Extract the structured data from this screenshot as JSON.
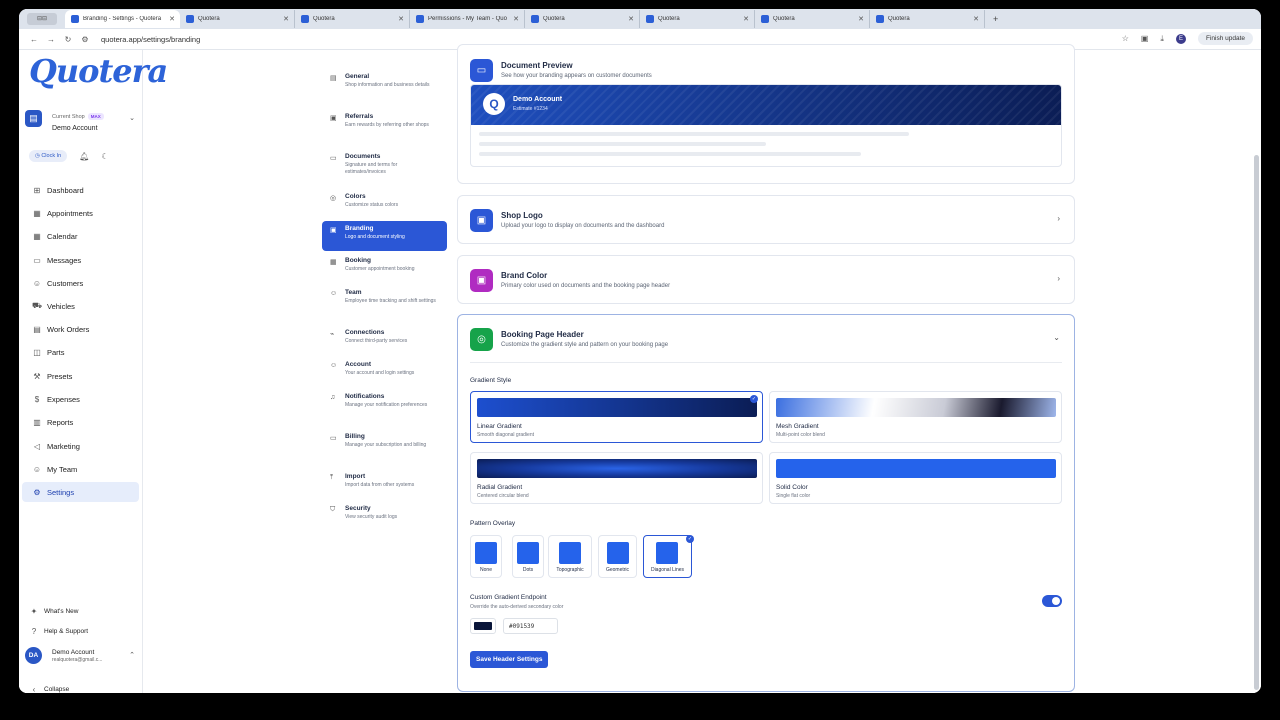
{
  "browser": {
    "home_tab": "⊟⊟",
    "tabs": [
      {
        "title": "Branding - Settings - Quotera",
        "active": true
      },
      {
        "title": "Quotera"
      },
      {
        "title": "Quotera"
      },
      {
        "title": "Permissions - My Team - Quo"
      },
      {
        "title": "Quotera"
      },
      {
        "title": "Quotera"
      },
      {
        "title": "Quotera"
      },
      {
        "title": "Quotera"
      }
    ],
    "new_tab": "+",
    "url": "quotera.app/settings/branding",
    "profile_initial": "E",
    "finish_update": "Finish update"
  },
  "sidebar": {
    "logo": "Quotera",
    "shop_label": "Current Shop",
    "shop_badge": "MAX",
    "shop_name": "Demo Account",
    "clock_in": "Clock In",
    "items": [
      {
        "label": "Dashboard",
        "icon": "grid-icon"
      },
      {
        "label": "Appointments",
        "icon": "calendar-check-icon"
      },
      {
        "label": "Calendar",
        "icon": "calendar-icon"
      },
      {
        "label": "Messages",
        "icon": "message-icon"
      },
      {
        "label": "Customers",
        "icon": "users-icon"
      },
      {
        "label": "Vehicles",
        "icon": "car-icon"
      },
      {
        "label": "Work Orders",
        "icon": "clipboard-icon"
      },
      {
        "label": "Parts",
        "icon": "box-icon"
      },
      {
        "label": "Presets",
        "icon": "wrench-icon"
      },
      {
        "label": "Expenses",
        "icon": "dollar-icon"
      },
      {
        "label": "Reports",
        "icon": "chart-icon"
      },
      {
        "label": "Marketing",
        "icon": "megaphone-icon"
      },
      {
        "label": "My Team",
        "icon": "team-icon"
      },
      {
        "label": "Settings",
        "icon": "gear-icon",
        "active": true
      }
    ],
    "whats_new": "What's New",
    "help": "Help & Support",
    "user_initials": "DA",
    "user_name": "Demo Account",
    "user_email": "realquotera@gmail.c...",
    "collapse": "Collapse"
  },
  "settings_nav": [
    {
      "title": "General",
      "desc": "Shop information and business details"
    },
    {
      "title": "Referrals",
      "desc": "Earn rewards by referring other shops"
    },
    {
      "title": "Documents",
      "desc": "Signature and terms for estimates/invoices"
    },
    {
      "title": "Colors",
      "desc": "Customize status colors"
    },
    {
      "title": "Branding",
      "desc": "Logo and document styling",
      "active": true
    },
    {
      "title": "Booking",
      "desc": "Customer appointment booking"
    },
    {
      "title": "Team",
      "desc": "Employee time tracking and shift settings"
    },
    {
      "title": "Connections",
      "desc": "Connect third-party services"
    },
    {
      "title": "Account",
      "desc": "Your account and login settings"
    },
    {
      "title": "Notifications",
      "desc": "Manage your notification preferences"
    },
    {
      "title": "Billing",
      "desc": "Manage your subscription and billing"
    },
    {
      "title": "Import",
      "desc": "Import data from other systems"
    },
    {
      "title": "Security",
      "desc": "View security audit logs"
    }
  ],
  "preview_card": {
    "title": "Document Preview",
    "desc": "See how your branding appears on customer documents",
    "account": "Demo Account",
    "estimate": "Estimate #1234"
  },
  "logo_card": {
    "title": "Shop Logo",
    "desc": "Upload your logo to display on documents and the dashboard"
  },
  "color_card": {
    "title": "Brand Color",
    "desc": "Primary color used on documents and the booking page header"
  },
  "header_card": {
    "title": "Booking Page Header",
    "desc": "Customize the gradient style and pattern on your booking page",
    "gradient_label": "Gradient Style",
    "gradients": [
      {
        "name": "Linear Gradient",
        "desc": "Smooth diagonal gradient",
        "selected": true
      },
      {
        "name": "Mesh Gradient",
        "desc": "Multi-point color blend"
      },
      {
        "name": "Radial Gradient",
        "desc": "Centered circular blend"
      },
      {
        "name": "Solid Color",
        "desc": "Single flat color"
      }
    ],
    "pattern_label": "Pattern Overlay",
    "patterns": [
      {
        "name": "None"
      },
      {
        "name": "Dots"
      },
      {
        "name": "Topographic"
      },
      {
        "name": "Geometric"
      },
      {
        "name": "Diagonal Lines",
        "selected": true
      }
    ],
    "endpoint_title": "Custom Gradient Endpoint",
    "endpoint_desc": "Override the auto-derived secondary color",
    "endpoint_enabled": true,
    "endpoint_color": "#091539",
    "save_label": "Save Header Settings"
  },
  "colors": {
    "accent": "#2b57d6",
    "primary_blue": "#2563eb",
    "endpoint": "#091539"
  }
}
